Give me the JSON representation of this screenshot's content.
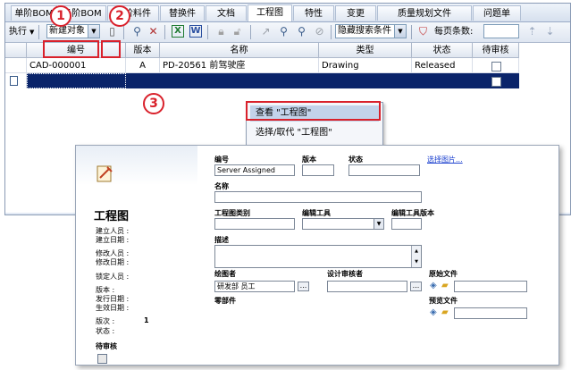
{
  "tabs": [
    "单阶BOM",
    "多阶BOM",
    "父阶料件",
    "替换件",
    "文档",
    "工程图",
    "特性",
    "变更",
    "质量规划文件",
    "问题单"
  ],
  "toolbar": {
    "run_label": "执行",
    "new_object": "新建对象",
    "hidden_search": "隐藏搜索条件",
    "per_page": "每页条数:"
  },
  "grid": {
    "headers": [
      "编号",
      "版本",
      "名称",
      "类型",
      "状态",
      "待审核"
    ],
    "rows": [
      {
        "number": "CAD-000001",
        "version": "A",
        "name": "PD-20561 前驾驶座",
        "type": "Drawing",
        "status": "Released"
      }
    ]
  },
  "context_menu": {
    "items": [
      "查看 \"工程图\"",
      "选择/取代 \"工程图\""
    ]
  },
  "badges": [
    "1",
    "2",
    "3"
  ],
  "form": {
    "title": "工程图",
    "meta_labels": [
      "建立人员 :",
      "建立日期 :",
      "修改人员 :",
      "修改日期 :",
      "锁定人员 :",
      "版本 :",
      "发行日期 :",
      "生效日期 :",
      "版次 :",
      "状态 :"
    ],
    "revision_value": "1",
    "pending_review": "待审核",
    "fields": {
      "number_label": "编号",
      "number_value": "Server Assigned",
      "version_label": "版本",
      "state_label": "状态",
      "choose_image": "选择图片...",
      "name_label": "名称",
      "drawing_type_label": "工程图类别",
      "edit_tool_label": "编辑工具",
      "edit_tool_version_label": "编辑工具版本",
      "description_label": "描述",
      "drafter_label": "绘图者",
      "drafter_value": "研发部 员工",
      "design_reviewer_label": "设计审核者",
      "original_file_label": "原始文件",
      "parts_label": "零部件",
      "preview_file_label": "预览文件"
    }
  },
  "colors": {
    "highlight_red": "#d9212b",
    "selection_blue": "#0a246a",
    "link_blue": "#1a3fcf",
    "arrow_orange": "#f0a22a"
  }
}
